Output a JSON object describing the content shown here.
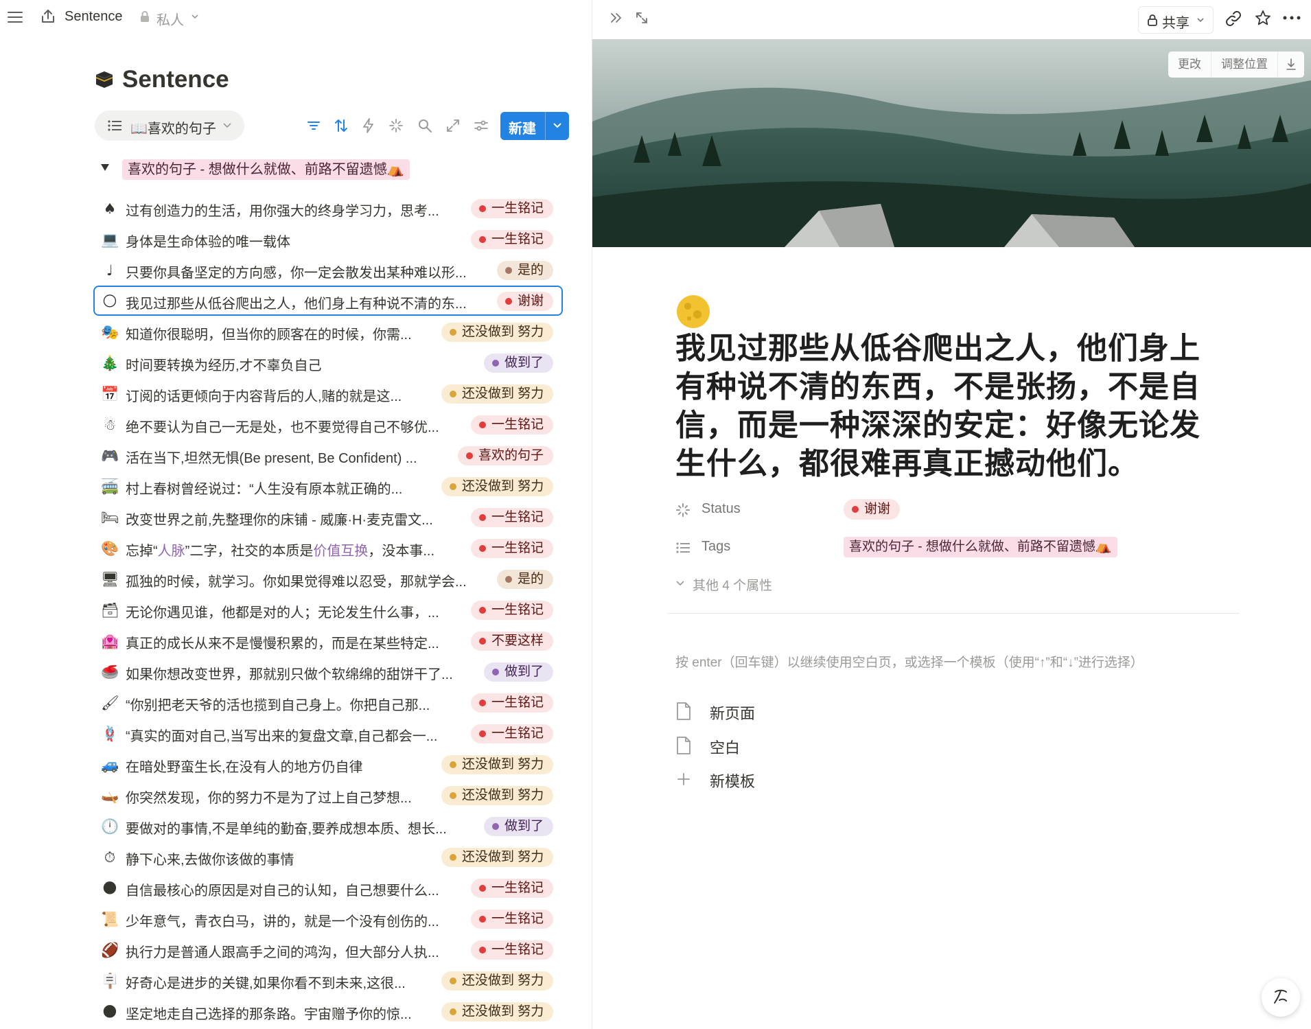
{
  "topbar": {
    "title": "Sentence",
    "privacy": "私人"
  },
  "database": {
    "title": "Sentence",
    "view_label": "📖喜欢的句子",
    "new_button": "新建"
  },
  "group": {
    "label": "喜欢的句子 - 想做什么就做、前路不留遗憾⛺"
  },
  "tag_colors": {
    "一生铭记": {
      "bg": "#fbe4e4",
      "fg": "#5d1715",
      "dot": "#e03e3e"
    },
    "是的": {
      "bg": "#f4e5d9",
      "fg": "#49290e",
      "dot": "#a27763"
    },
    "谢谢": {
      "bg": "#fbe4e4",
      "fg": "#5d1715",
      "dot": "#e03e3e"
    },
    "还没做到 努力": {
      "bg": "#faecd3",
      "fg": "#402c1b",
      "dot": "#d9a53b"
    },
    "做到了": {
      "bg": "#eae4f2",
      "fg": "#412454",
      "dot": "#9065b0"
    },
    "喜欢的句子": {
      "bg": "#fbe4e4",
      "fg": "#5d1715",
      "dot": "#e03e3e"
    },
    "不要这样": {
      "bg": "#fbe4e4",
      "fg": "#5d1715",
      "dot": "#e03e3e"
    }
  },
  "rows": [
    {
      "emoji": "♠",
      "text": "过有创造力的生活，用你强大的终身学习力，思考...",
      "status": "一生铭记"
    },
    {
      "emoji": "💻",
      "text": "身体是生命体验的唯一载体",
      "status": "一生铭记"
    },
    {
      "emoji": "♩",
      "text": "只要你具备坚定的方向感，你一定会散发出某种难以形...",
      "status": "是的"
    },
    {
      "emoji": "🌕",
      "text": "我见过那些从低谷爬出之人，他们身上有种说不清的东...",
      "status": "谢谢",
      "selected": true
    },
    {
      "emoji": "🎭",
      "text": "知道你很聪明，但当你的顾客在的时候，你需...",
      "status": "还没做到 努力"
    },
    {
      "emoji": "🎄",
      "text": "时间要转换为经历,才不辜负自己",
      "status": "做到了"
    },
    {
      "emoji": "📅",
      "text": "订阅的话更倾向于内容背后的人,赌的就是这...",
      "status": "还没做到 努力"
    },
    {
      "emoji": "☃",
      "text": "绝不要认为自己一无是处，也不要觉得自己不够优...",
      "status": "一生铭记"
    },
    {
      "emoji": "🎮",
      "text": "活在当下,坦然无惧(Be present, Be Confident) ...",
      "status": "喜欢的句子"
    },
    {
      "emoji": "🚎",
      "text": "村上春树曾经说过：“人生没有原本就正确的...",
      "status": "还没做到 努力"
    },
    {
      "emoji": "🛏",
      "text": "改变世界之前,先整理你的床铺 - 威廉·H·麦克雷文...",
      "status": "一生铭记"
    },
    {
      "emoji": "🎨",
      "text_pre": "忘掉“",
      "text_hl1": "人脉",
      "text_mid": "”二字，社交的本质是",
      "text_hl2": "价值互换",
      "text_post": "，没本事...",
      "status": "一生铭记",
      "rich": true
    },
    {
      "emoji": "🖥",
      "text": "孤独的时候，就学习。你如果觉得难以忍受，那就学会...",
      "status": "是的"
    },
    {
      "emoji": "🗃",
      "text": "无论你遇见谁，他都是对的人；无论发生什么事，...",
      "status": "一生铭记"
    },
    {
      "emoji": "🏩",
      "text": "真正的成长从来不是慢慢积累的，而是在某些特定...",
      "status": "不要这样"
    },
    {
      "emoji": "🥌",
      "text": "如果你想改变世界，那就别只做个软绵绵的甜饼干了...",
      "status": "做到了"
    },
    {
      "emoji": "🖌",
      "text": "“你别把老天爷的活也揽到自己身上。你把自己那...",
      "status": "一生铭记"
    },
    {
      "emoji": "🪢",
      "text": "“真实的面对自己,当写出来的复盘文章,自己都会一...",
      "status": "一生铭记"
    },
    {
      "emoji": "🚙",
      "text": "在暗处野蛮生长,在没有人的地方仍自律",
      "status": "还没做到 努力"
    },
    {
      "emoji": "🛶",
      "text": "你突然发现，你的努力不是为了过上自己梦想...",
      "status": "还没做到 努力"
    },
    {
      "emoji": "🕛",
      "text": "要做对的事情,不是单纯的勤奋,要养成想本质、想长...",
      "status": "做到了"
    },
    {
      "emoji": "⏱",
      "text": "静下心来,去做你该做的事情",
      "status": "还没做到 努力"
    },
    {
      "emoji": "🌑",
      "text": "自信最核心的原因是对自己的认知，自己想要什么...",
      "status": "一生铭记"
    },
    {
      "emoji": "📜",
      "text": "少年意气，青衣白马，讲的，就是一个没有创伤的...",
      "status": "一生铭记"
    },
    {
      "emoji": "🏈",
      "text": "执行力是普通人跟高手之间的鸿沟，但大部分人执...",
      "status": "一生铭记"
    },
    {
      "emoji": "🪧",
      "text": "好奇心是进步的关键,如果你看不到未来,这很...",
      "status": "还没做到 努力"
    },
    {
      "emoji": "🌑",
      "text": "坚定地走自己选择的那条路。宇宙赠予你的惊...",
      "status": "还没做到 努力"
    }
  ],
  "detail": {
    "share_label": "共享",
    "cover_buttons": {
      "change": "更改",
      "reposition": "调整位置"
    },
    "title": "我见过那些从低谷爬出之人，他们身上有种说不清的东西，不是张扬，不是自信，而是一种深深的安定：好像无论发生什么，都很难再真正撼动他们。",
    "props": {
      "status_name": "Status",
      "status_value": "谢谢",
      "tags_name": "Tags",
      "tags_value": "喜欢的句子 - 想做什么就做、前路不留遗憾⛺"
    },
    "more_props": "其他 4 个属性",
    "hint": "按 enter（回车键）以继续使用空白页，或选择一个模板（使用“↑”和“↓”进行选择）",
    "templates": [
      "新页面",
      "空白",
      "新模板"
    ]
  }
}
